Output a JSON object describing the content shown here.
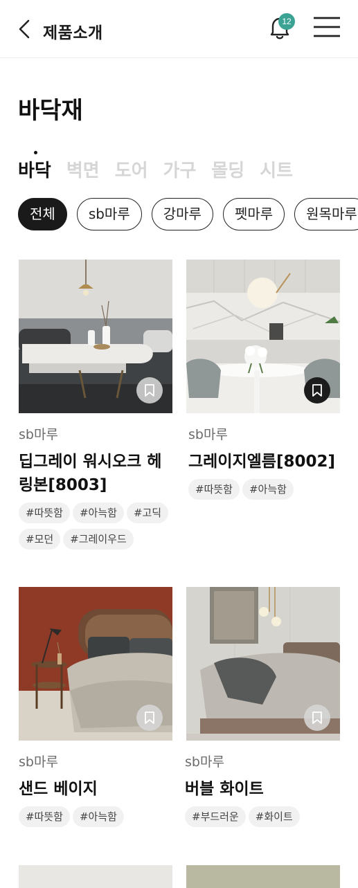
{
  "header": {
    "title": "제품소개",
    "notification_count": "12"
  },
  "page_title": "바닥재",
  "category_tabs": [
    {
      "label": "바닥",
      "active": true
    },
    {
      "label": "벽면",
      "active": false
    },
    {
      "label": "도어",
      "active": false
    },
    {
      "label": "가구",
      "active": false
    },
    {
      "label": "몰딩",
      "active": false
    },
    {
      "label": "시트",
      "active": false
    }
  ],
  "filter_chips": [
    {
      "label": "전체",
      "active": true
    },
    {
      "label": "sb마루",
      "active": false
    },
    {
      "label": "강마루",
      "active": false
    },
    {
      "label": "펫마루",
      "active": false
    },
    {
      "label": "원목마루",
      "active": false
    }
  ],
  "products": [
    {
      "category": "sb마루",
      "name": "딥그레이 워시오크 헤링본[8003]",
      "tags": [
        "#따뜻함",
        "#아늑함",
        "#고딕",
        "#모던",
        "#그레이우드"
      ],
      "bookmark_style": "light"
    },
    {
      "category": "sb마루",
      "name": "그레이지엘름[8002]",
      "tags": [
        "#따뜻함",
        "#아늑함"
      ],
      "bookmark_style": "dark"
    },
    {
      "category": "sb마루",
      "name": "샌드 베이지",
      "tags": [
        "#따뜻함",
        "#아늑함"
      ],
      "bookmark_style": "light"
    },
    {
      "category": "sb마루",
      "name": "버블 화이트",
      "tags": [
        "#부드러운",
        "#화이트"
      ],
      "bookmark_style": "light"
    }
  ],
  "icons": {
    "back": "chevron-left-icon",
    "notification": "bell-icon",
    "menu": "hamburger-menu-icon",
    "bookmark": "bookmark-icon"
  },
  "colors": {
    "badge": "#3aa394",
    "active_chip": "#1a1a1a",
    "inactive_tab": "#d6d6d6",
    "tag_bg": "#f1f1f1"
  }
}
